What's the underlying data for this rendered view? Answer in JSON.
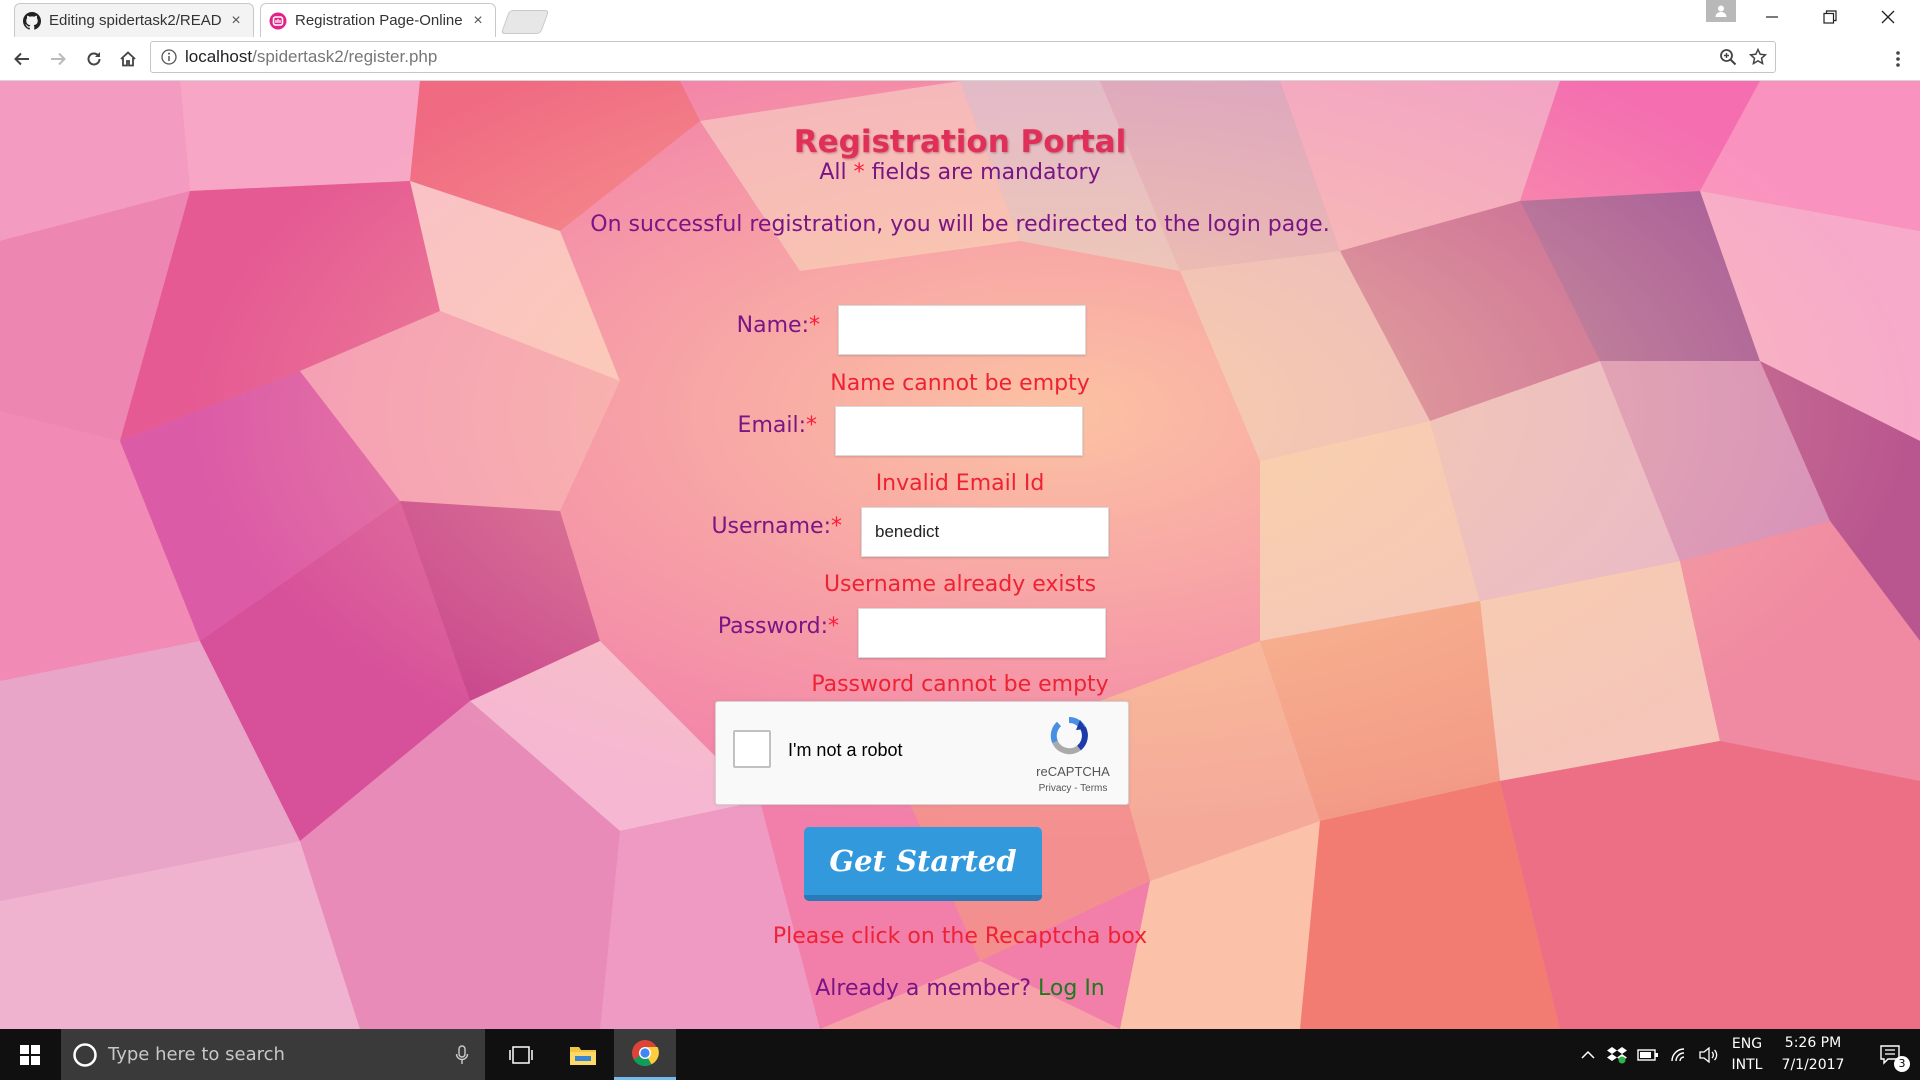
{
  "browser": {
    "tabs": [
      {
        "title": "Editing spidertask2/READ",
        "favicon": "github-icon",
        "active": false
      },
      {
        "title": "Registration Page-Online",
        "favicon": "site-logo-icon",
        "active": true
      }
    ],
    "close_glyph": "×",
    "url_host": "localhost",
    "url_path": "/spidertask2/register.php"
  },
  "page": {
    "title": "Registration Portal",
    "mandatory_prefix": "All ",
    "mandatory_star": "*",
    "mandatory_suffix": " fields are mandatory",
    "redirect_note": "On successful registration, you will be redirected to the login page.",
    "fields": [
      {
        "label": "Name:",
        "star": "*",
        "value": "",
        "error": "Name cannot be empty"
      },
      {
        "label": "Email:",
        "star": "*",
        "value": "",
        "error": "Invalid Email Id"
      },
      {
        "label": "Username:",
        "star": "*",
        "value": "benedict",
        "error": "Username already exists"
      },
      {
        "label": "Password:",
        "star": "*",
        "value": "",
        "error": "Password cannot be empty"
      }
    ],
    "captcha": {
      "label": "I'm not a robot",
      "brand": "reCAPTCHA",
      "links": "Privacy - Terms"
    },
    "submit_label": "Get Started",
    "captcha_error": "Please click on the Recaptcha box",
    "member_prompt": "Already a member? ",
    "login_link": "Log In",
    "colors": {
      "title": "#e0305a",
      "info": "#7a1585",
      "error": "#ee2233",
      "button": "#3399dd",
      "login_link": "#1e7a1e"
    }
  },
  "taskbar": {
    "search_placeholder": "Type here to search",
    "lang_top": "ENG",
    "lang_bottom": "INTL",
    "time": "5:26 PM",
    "date": "7/1/2017",
    "notification_count": "3"
  }
}
